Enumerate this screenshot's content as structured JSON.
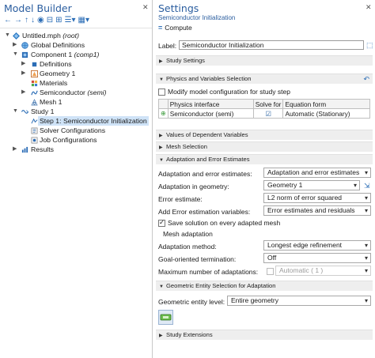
{
  "model_builder": {
    "title": "Model Builder",
    "tree": [
      {
        "label": "Untitled.mph",
        "suffix": "(root)"
      },
      {
        "label": "Global Definitions"
      },
      {
        "label": "Component 1",
        "suffix": "(comp1)"
      },
      {
        "label": "Definitions"
      },
      {
        "label": "Geometry 1"
      },
      {
        "label": "Materials"
      },
      {
        "label": "Semiconductor",
        "suffix": "(semi)"
      },
      {
        "label": "Mesh 1"
      },
      {
        "label": "Study 1"
      },
      {
        "label": "Step 1: Semiconductor Initialization"
      },
      {
        "label": "Solver Configurations"
      },
      {
        "label": "Job Configurations"
      },
      {
        "label": "Results"
      }
    ]
  },
  "settings": {
    "title": "Settings",
    "subtitle": "Semiconductor Initialization",
    "compute_label": "Compute",
    "label_caption": "Label:",
    "label_value": "Semiconductor Initialization",
    "sections": {
      "study_settings": "Study Settings",
      "physics_vars": "Physics and Variables Selection",
      "dependent_values": "Values of Dependent Variables",
      "mesh_selection": "Mesh Selection",
      "adaptation": "Adaptation and Error Estimates",
      "geom_entity": "Geometric Entity Selection for Adaptation",
      "study_extensions": "Study Extensions"
    },
    "modify_config_label": "Modify model configuration for study step",
    "physics_table": {
      "headers": [
        "Physics interface",
        "Solve for",
        "Equation form"
      ],
      "row": {
        "interface": "Semiconductor (semi)",
        "equation": "Automatic (Stationary)"
      }
    },
    "adapt": {
      "adapt_estimates_label": "Adaptation and error estimates:",
      "adapt_estimates_value": "Adaptation and error estimates",
      "adapt_geometry_label": "Adaptation in geometry:",
      "adapt_geometry_value": "Geometry 1",
      "error_estimate_label": "Error estimate:",
      "error_estimate_value": "L2 norm of error squared",
      "add_error_vars_label": "Add Error estimation variables:",
      "add_error_vars_value": "Error estimates and residuals",
      "save_solution_label": "Save solution on every adapted mesh",
      "mesh_adaptation_header": "Mesh adaptation",
      "method_label": "Adaptation method:",
      "method_value": "Longest edge refinement",
      "goal_label": "Goal-oriented termination:",
      "goal_value": "Off",
      "max_adapt_label": "Maximum number of adaptations:",
      "max_adapt_value": "Automatic ( 1 )"
    },
    "geom_entity_level_label": "Geometric entity level:",
    "geom_entity_level_value": "Entire geometry"
  }
}
